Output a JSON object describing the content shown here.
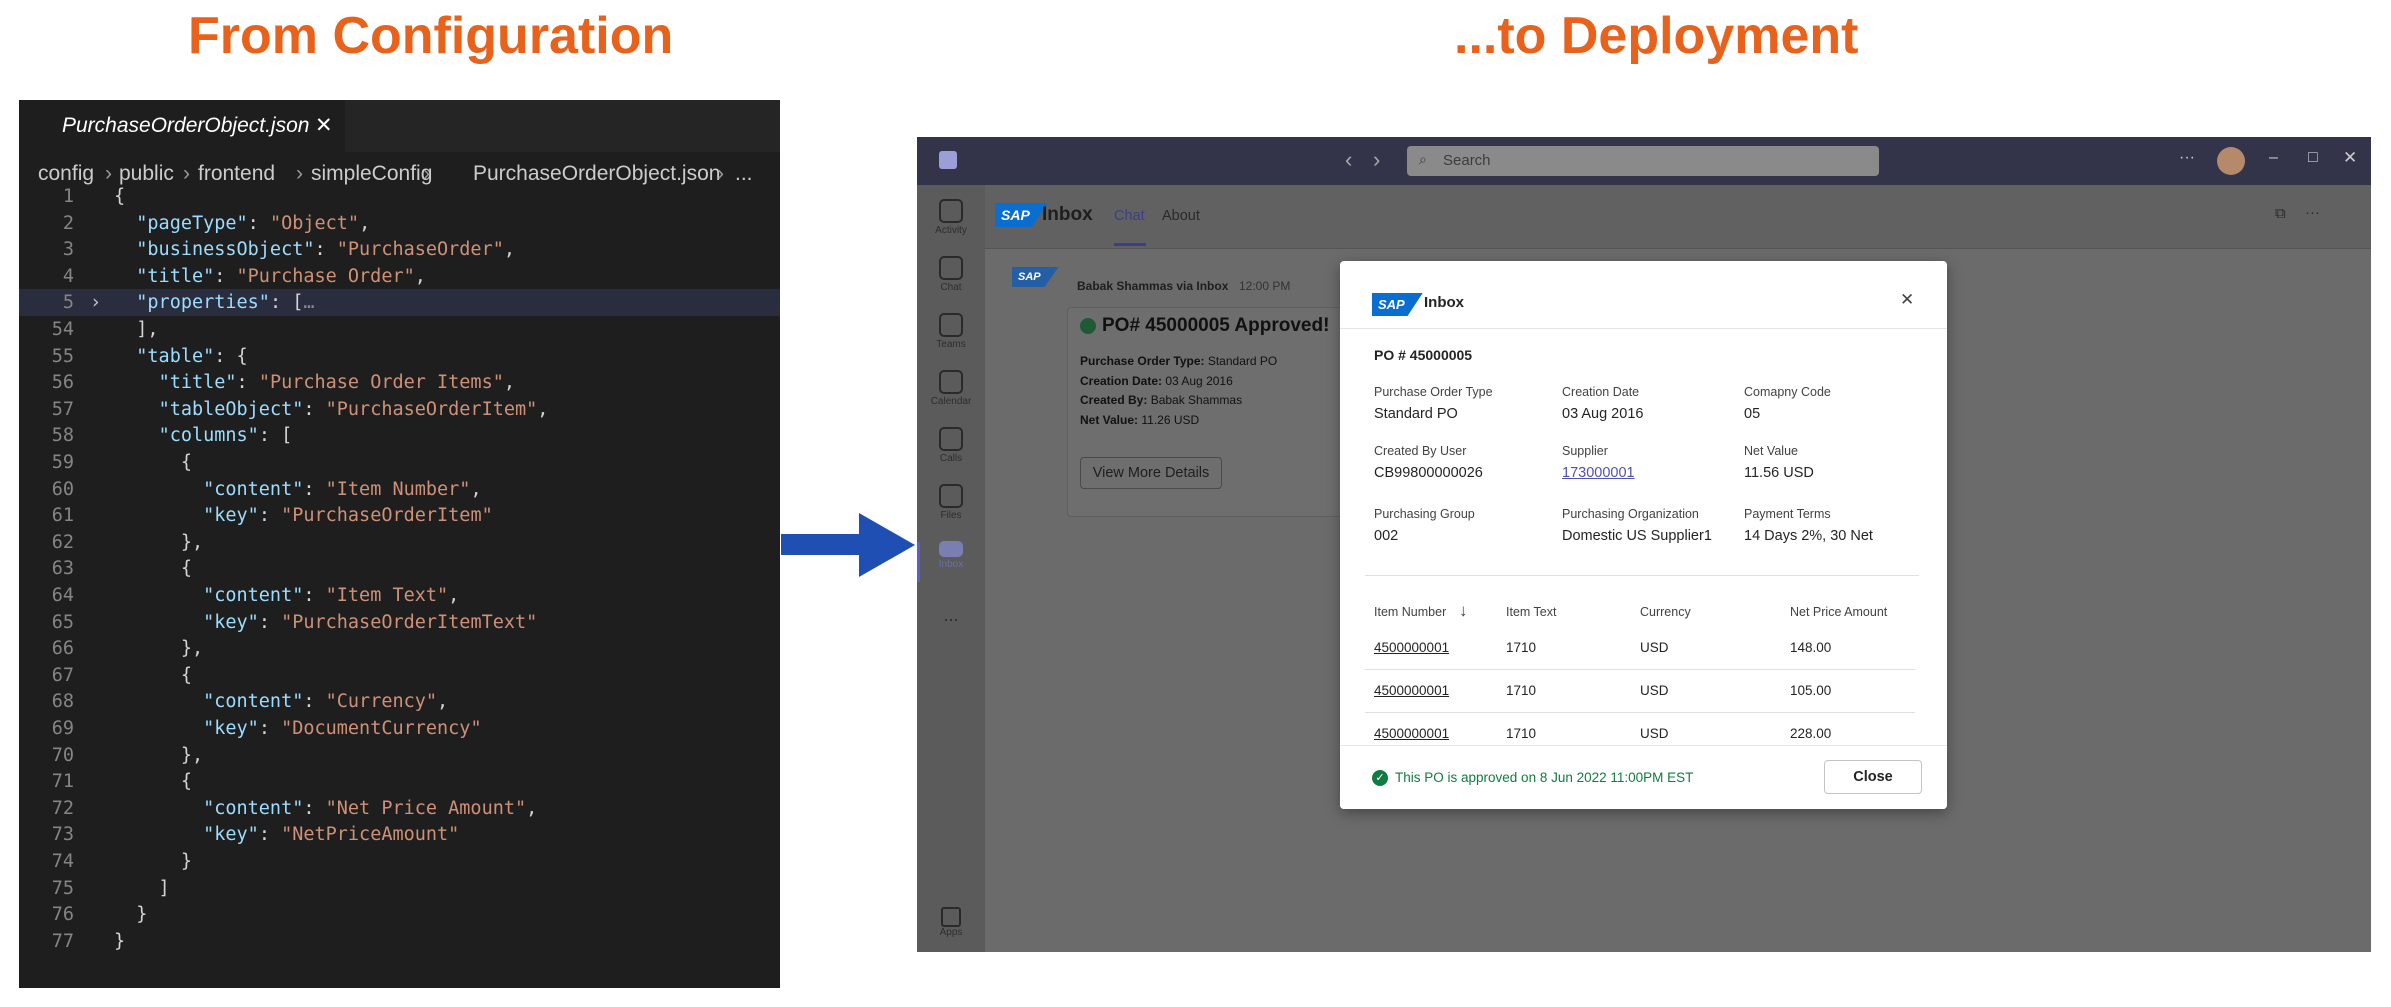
{
  "headings": {
    "left": "From Configuration",
    "right": "...to Deployment"
  },
  "editor": {
    "tab": "PurchaseOrderObject.json",
    "breadcrumb": [
      "config",
      "public",
      "frontend",
      "simpleConfig",
      "PurchaseOrderObject.json",
      "..."
    ],
    "lines": [
      {
        "n": "1",
        "t": "{"
      },
      {
        "n": "2",
        "t": "  \"pageType\": \"Object\","
      },
      {
        "n": "3",
        "t": "  \"businessObject\": \"PurchaseOrder\","
      },
      {
        "n": "4",
        "t": "  \"title\": \"Purchase Order\","
      },
      {
        "n": "5",
        "t": "  \"properties\": […"
      },
      {
        "n": "54",
        "t": "  ],"
      },
      {
        "n": "55",
        "t": "  \"table\": {"
      },
      {
        "n": "56",
        "t": "    \"title\": \"Purchase Order Items\","
      },
      {
        "n": "57",
        "t": "    \"tableObject\": \"PurchaseOrderItem\","
      },
      {
        "n": "58",
        "t": "    \"columns\": ["
      },
      {
        "n": "59",
        "t": "      {"
      },
      {
        "n": "60",
        "t": "        \"content\": \"Item Number\","
      },
      {
        "n": "61",
        "t": "        \"key\": \"PurchaseOrderItem\""
      },
      {
        "n": "62",
        "t": "      },"
      },
      {
        "n": "63",
        "t": "      {"
      },
      {
        "n": "64",
        "t": "        \"content\": \"Item Text\","
      },
      {
        "n": "65",
        "t": "        \"key\": \"PurchaseOrderItemText\""
      },
      {
        "n": "66",
        "t": "      },"
      },
      {
        "n": "67",
        "t": "      {"
      },
      {
        "n": "68",
        "t": "        \"content\": \"Currency\","
      },
      {
        "n": "69",
        "t": "        \"key\": \"DocumentCurrency\""
      },
      {
        "n": "70",
        "t": "      },"
      },
      {
        "n": "71",
        "t": "      {"
      },
      {
        "n": "72",
        "t": "        \"content\": \"Net Price Amount\","
      },
      {
        "n": "73",
        "t": "        \"key\": \"NetPriceAmount\""
      },
      {
        "n": "74",
        "t": "      }"
      },
      {
        "n": "75",
        "t": "    ]"
      },
      {
        "n": "76",
        "t": "  }"
      },
      {
        "n": "77",
        "t": "}"
      }
    ]
  },
  "teams": {
    "search_placeholder": "Search",
    "rail": [
      {
        "label": "Activity",
        "icon": "bell-icon"
      },
      {
        "label": "Chat",
        "icon": "chat-icon"
      },
      {
        "label": "Teams",
        "icon": "teams-icon"
      },
      {
        "label": "Calendar",
        "icon": "calendar-icon"
      },
      {
        "label": "Calls",
        "icon": "phone-icon"
      },
      {
        "label": "Files",
        "icon": "file-icon"
      },
      {
        "label": "Inbox",
        "icon": "sap-icon"
      }
    ],
    "more": "...",
    "apps_label": "Apps",
    "app_name": "Inbox",
    "tabs": [
      "Chat",
      "About"
    ],
    "sap": "SAP",
    "message": {
      "sender": "Babak Shammas via Inbox",
      "time": "12:00 PM",
      "title": "PO# 45000005 Approved!",
      "rows": [
        {
          "k": "Purchase Order Type:",
          "v": "Standard PO"
        },
        {
          "k": "Creation Date:",
          "v": "03 Aug 2016"
        },
        {
          "k": "Created By:",
          "v": "Babak Shammas"
        },
        {
          "k": "Net Value:",
          "v": "11.26 USD"
        }
      ],
      "button": "View More Details"
    }
  },
  "dialog": {
    "title": "Inbox",
    "po": "PO # 45000005",
    "fields": [
      {
        "label": "Purchase Order Type",
        "value": "Standard PO"
      },
      {
        "label": "Creation Date",
        "value": "03 Aug 2016"
      },
      {
        "label": "Comapny Code",
        "value": "05"
      },
      {
        "label": "Created By User",
        "value": "CB99800000026"
      },
      {
        "label": "Supplier",
        "value": "173000001"
      },
      {
        "label": "Net Value",
        "value": "11.56 USD"
      },
      {
        "label": "Purchasing Group",
        "value": "002"
      },
      {
        "label": "Purchasing Organization",
        "value": "Domestic US Supplier1"
      },
      {
        "label": "Payment Terms",
        "value": "14 Days 2%, 30 Net"
      }
    ],
    "table_headers": [
      "Item Number",
      "Item Text",
      "Currency",
      "Net Price Amount"
    ],
    "rows": [
      [
        "4500000001",
        "1710",
        "USD",
        "148.00"
      ],
      [
        "4500000001",
        "1710",
        "USD",
        "105.00"
      ],
      [
        "4500000001",
        "1710",
        "USD",
        "228.00"
      ]
    ],
    "status": "This PO is approved on 8 Jun 2022 11:00PM EST",
    "close": "Close"
  },
  "colors": {
    "heading": "#e8621c",
    "arrow": "#1f4fb2",
    "teams_bar": "#33344a",
    "sap_blue": "#0a6ed1",
    "success": "#107c41"
  }
}
